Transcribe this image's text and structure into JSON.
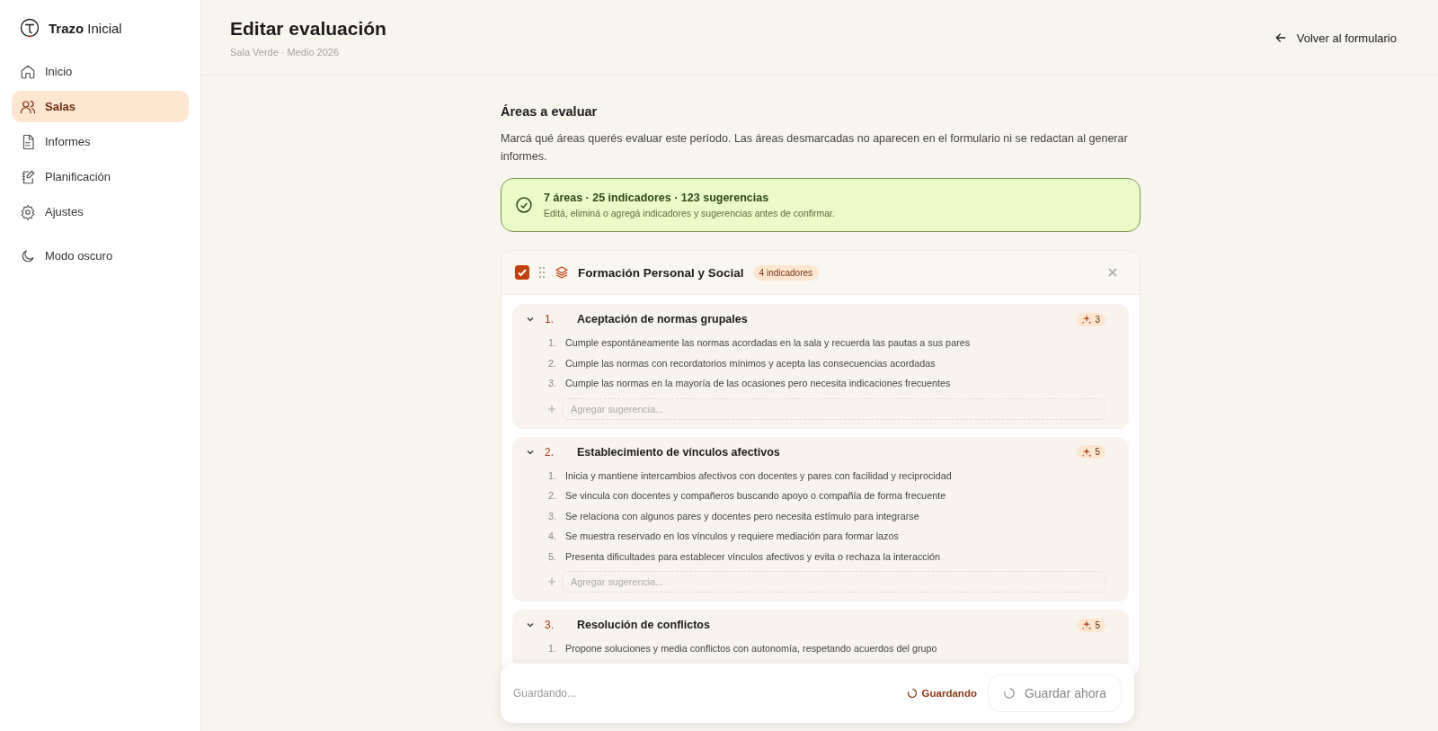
{
  "sidebar": {
    "brand": "**Trazo** Inicial",
    "items": [
      {
        "label": "Inicio",
        "selected": false
      },
      {
        "label": "Salas",
        "selected": true
      },
      {
        "label": "Informes",
        "selected": false
      },
      {
        "label": "Planificación",
        "selected": false
      },
      {
        "label": "Ajustes",
        "selected": false
      }
    ],
    "theme_toggle": {
      "label": "Modo oscuro"
    }
  },
  "header": {
    "title": "Editar evaluación",
    "subtitle": "Sala Verde · Medio 2026",
    "back_link": "Volver al formulario"
  },
  "section": {
    "title": "Áreas a evaluar",
    "description": "Marcá qué áreas querés evaluar este período. Las áreas desmarcadas no aparecen en el formulario ni se redactan al generar informes."
  },
  "summary": {
    "title": "7 áreas · 25 indicadores · 123 sugerencias",
    "subtitle": "Editá, eliminá o agregá indicadores y sugerencias antes de confirmar."
  },
  "area": {
    "checked": true,
    "title": "Formación Personal y Social",
    "badge": "4 indicadores",
    "indicators": [
      {
        "number": "1.",
        "title": "Aceptación de normas grupales",
        "count": "3",
        "expanded": true,
        "suggestions": [
          {
            "number": "1.",
            "text": "Cumple espontáneamente las normas acordadas en la sala y recuerda las pautas a sus pares"
          },
          {
            "number": "2.",
            "text": "Cumple las normas con recordatorios mínimos y acepta las consecuencias acordadas"
          },
          {
            "number": "3.",
            "text": "Cumple las normas en la mayoría de las ocasiones pero necesita indicaciones frecuentes"
          }
        ],
        "add_placeholder": "Agregar sugerencia..."
      },
      {
        "number": "2.",
        "title": "Establecimiento de vínculos afectivos",
        "count": "5",
        "expanded": true,
        "suggestions": [
          {
            "number": "1.",
            "text": "Inicia y mantiene intercambios afectivos con docentes y pares con facilidad y reciprocidad"
          },
          {
            "number": "2.",
            "text": "Se vincula con docentes y compañeros buscando apoyo o compañía de forma frecuente"
          },
          {
            "number": "3.",
            "text": "Se relaciona con algunos pares y docentes pero necesita estímulo para integrarse"
          },
          {
            "number": "4.",
            "text": "Se muestra reservado en los vínculos y requiere mediación para formar lazos"
          },
          {
            "number": "5.",
            "text": "Presenta dificultades para establecer vínculos afectivos y evita o rechaza la interacción"
          }
        ],
        "add_placeholder": "Agregar sugerencia..."
      },
      {
        "number": "3.",
        "title": "Resolución de conflictos",
        "count": "5",
        "expanded": true,
        "suggestions": [
          {
            "number": "1.",
            "text": "Propone soluciones y media conflictos con autonomía, respetando acuerdos del grupo"
          }
        ]
      }
    ]
  },
  "save_bar": {
    "status": "Guardando...",
    "state_label": "Guardando",
    "button": "Guardar ahora",
    "button_disabled": true
  }
}
